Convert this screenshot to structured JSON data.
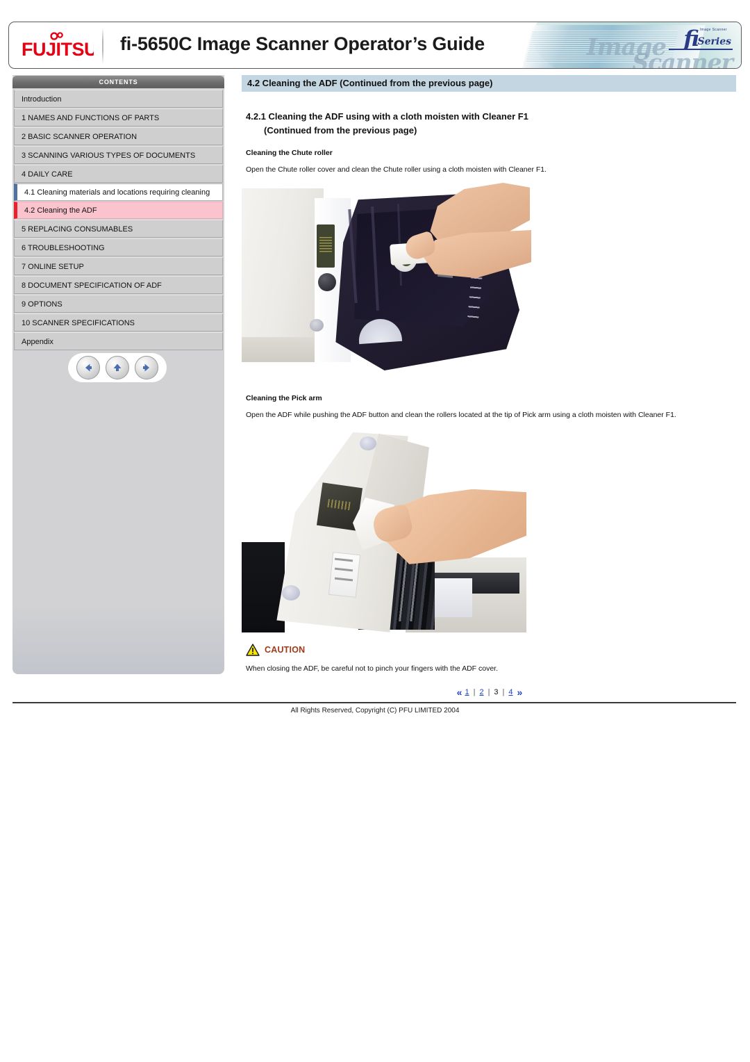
{
  "header": {
    "brand": "FUJITSU",
    "title": "fi-5650C Image Scanner Operator’s Guide",
    "artwork": {
      "fi": "fi",
      "series": "Series",
      "tiny": "Image Scanner",
      "word_image": "Image",
      "word_scanner": "Scanner"
    }
  },
  "sidebar": {
    "heading": "CONTENTS",
    "items": [
      {
        "label": "Introduction",
        "type": "plain"
      },
      {
        "label": "1 NAMES AND FUNCTIONS OF PARTS",
        "type": "caps"
      },
      {
        "label": "2 BASIC SCANNER OPERATION",
        "type": "caps"
      },
      {
        "label": "3 SCANNING VARIOUS TYPES OF DOCUMENTS",
        "type": "caps"
      },
      {
        "label": "4 DAILY CARE",
        "type": "caps"
      }
    ],
    "sub_items": [
      {
        "label": "4.1 Cleaning materials and locations requiring cleaning",
        "active": false
      },
      {
        "label": "4.2 Cleaning the ADF",
        "active": true
      }
    ],
    "items_after": [
      {
        "label": "5 REPLACING CONSUMABLES",
        "type": "caps"
      },
      {
        "label": "6 TROUBLESHOOTING",
        "type": "caps"
      },
      {
        "label": "7 ONLINE SETUP",
        "type": "caps"
      },
      {
        "label": "8 DOCUMENT SPECIFICATION OF ADF",
        "type": "caps"
      },
      {
        "label": "9 OPTIONS",
        "type": "caps"
      },
      {
        "label": "10 SCANNER SPECIFICATIONS",
        "type": "caps"
      },
      {
        "label": "Appendix",
        "type": "plain"
      }
    ],
    "nav": {
      "back": "back-arrow-icon",
      "up": "up-arrow-icon",
      "forward": "forward-arrow-icon"
    }
  },
  "main": {
    "section_banner": "4.2 Cleaning the ADF (Continued from the previous page)",
    "subsection_title": "4.2.1 Cleaning the ADF using with a cloth moisten with Cleaner F1",
    "subsection_continued": "(Continued from the previous page)",
    "blocks": [
      {
        "label": "Cleaning the Chute roller",
        "text": "Open the Chute roller cover and clean the Chute roller using a cloth moisten with Cleaner F1.",
        "image_name": "chute-roller-cleaning-photo"
      },
      {
        "label": "Cleaning the Pick arm",
        "text": "Open the ADF while pushing the ADF button and clean the rollers located at the tip of Pick arm using a cloth moisten with Cleaner F1.",
        "image_name": "pick-arm-cleaning-photo"
      }
    ],
    "caution": {
      "word": "CAUTION",
      "text": "When closing the ADF, be careful not to pinch your fingers with the ADF cover."
    },
    "pager": {
      "prev": "«",
      "next": "»",
      "pages": [
        "1",
        "2",
        "3",
        "4"
      ],
      "current": "3",
      "separator": "|"
    }
  },
  "footer": {
    "copyright": "All Rights Reserved, Copyright (C) PFU LIMITED 2004"
  },
  "colors": {
    "accent_red": "#e8212f",
    "banner_blue": "#c3d6e1",
    "active_pink": "#fbc3cd",
    "link_blue": "#1a3fd0",
    "caution_brown": "#a03a18"
  }
}
